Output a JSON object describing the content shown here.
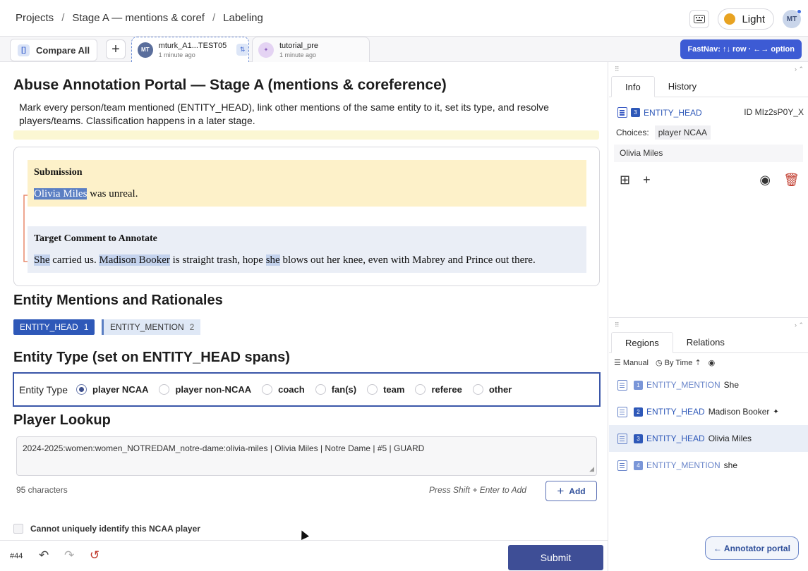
{
  "breadcrumb": {
    "projects": "Projects",
    "separator": "/",
    "project": "Stage A — mentions & coref",
    "current": "Labeling"
  },
  "topbar": {
    "theme_label": "Light",
    "avatar_initials": "MT"
  },
  "tabs": {
    "compare_label": "Compare All",
    "plus": "+",
    "items": [
      {
        "avatar": "MT",
        "title": "mturk_A1...TEST05",
        "subtitle": "1 minute ago"
      },
      {
        "avatar": "✦",
        "title": "tutorial_pre",
        "subtitle": "1 minute ago"
      }
    ],
    "fastnav": "FastNav: ↑↓ row · ←→ option"
  },
  "main": {
    "title": "Abuse Annotation Portal — Stage A (mentions & coreference)",
    "description": "Mark every person/team mentioned (ENTITY_HEAD), link other mentions of the same entity to it, set its type, and resolve players/teams. Classification happens in a later stage.",
    "submission": {
      "heading": "Submission",
      "span": "Olivia Miles",
      "rest": " was unreal."
    },
    "target": {
      "heading": "Target Comment to Annotate",
      "span1": "She",
      "text1": " carried us. ",
      "span2": "Madison Booker",
      "text2": " is straight trash, hope ",
      "span3": "she",
      "text3": " blows out her knee, even with Mabrey and Prince out there."
    },
    "mentions_heading": "Entity Mentions and Rationales",
    "labels": [
      {
        "name": "ENTITY_HEAD",
        "count": "1"
      },
      {
        "name": "ENTITY_MENTION",
        "count": "2"
      }
    ],
    "entity_type_heading": "Entity Type (set on ENTITY_HEAD spans)",
    "entity_type_label": "Entity Type",
    "entity_type_options": [
      "player NCAA",
      "player non-NCAA",
      "coach",
      "fan(s)",
      "team",
      "referee",
      "other"
    ],
    "entity_type_selected": "player NCAA",
    "lookup_heading": "Player Lookup",
    "lookup_value": "2024-2025:women:women_NOTREDAM_notre-dame:olivia-miles | Olivia Miles | Notre Dame | #5 | GUARD",
    "char_count": "95 characters",
    "hint": "Press Shift + Enter to Add",
    "add_label": "Add",
    "checkbox_label": "Cannot uniquely identify this NCAA player"
  },
  "footer": {
    "task_number": "#44",
    "submit_label": "Submit"
  },
  "sidebar": {
    "info_tabs": [
      "Info",
      "History"
    ],
    "selected": {
      "index": "3",
      "label": "ENTITY_HEAD",
      "id": "ID MIz2sP0Y_X",
      "choices_label": "Choices:",
      "choice": "player NCAA",
      "text": "Olivia Miles"
    },
    "region_tabs": [
      "Regions",
      "Relations"
    ],
    "sort": {
      "manual": "Manual",
      "by_time": "By Time"
    },
    "regions": [
      {
        "index": "1",
        "label": "ENTITY_MENTION",
        "text": "She",
        "type": "mention"
      },
      {
        "index": "2",
        "label": "ENTITY_HEAD",
        "text": "Madison Booker",
        "type": "head",
        "extra": "✦"
      },
      {
        "index": "3",
        "label": "ENTITY_HEAD",
        "text": "Olivia Miles",
        "type": "head"
      },
      {
        "index": "4",
        "label": "ENTITY_MENTION",
        "text": "she",
        "type": "mention"
      }
    ],
    "portal_button": "← Annotator portal"
  },
  "colors": {
    "accent": "#3d5bd4",
    "entity_head": "#2e58b8",
    "entity_mention": "#c3d2ed",
    "submit": "#3e4e96",
    "relation_arrow": "#e8896b"
  }
}
